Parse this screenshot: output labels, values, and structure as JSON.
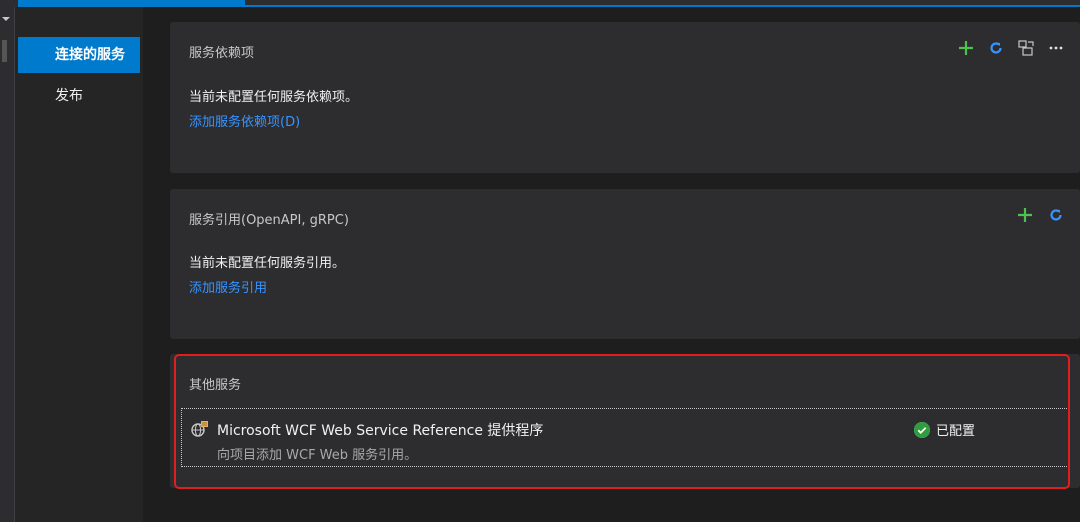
{
  "sidebar": {
    "items": [
      {
        "label": "连接的服务"
      },
      {
        "label": "发布"
      }
    ]
  },
  "sections": {
    "dependencies": {
      "title": "服务依赖项",
      "empty_text": "当前未配置任何服务依赖项。",
      "add_link": "添加服务依赖项(D)",
      "actions": [
        "add-icon",
        "refresh-icon",
        "manage-icon",
        "more-icon"
      ]
    },
    "references": {
      "title": "服务引用(OpenAPI, gRPC)",
      "empty_text": "当前未配置任何服务引用。",
      "add_link": "添加服务引用",
      "actions": [
        "add-icon",
        "refresh-icon"
      ]
    },
    "other": {
      "title": "其他服务",
      "provider": {
        "name": "Microsoft WCF Web Service Reference 提供程序",
        "description": "向项目添加 WCF Web 服务引用。",
        "status": "已配置",
        "icon": "wcf-provider-icon"
      }
    }
  },
  "colors": {
    "accent": "#007acc",
    "link": "#3794ff",
    "add": "#4fc14f",
    "highlight": "#e01e1e",
    "status_ok": "#2e9c3f"
  }
}
